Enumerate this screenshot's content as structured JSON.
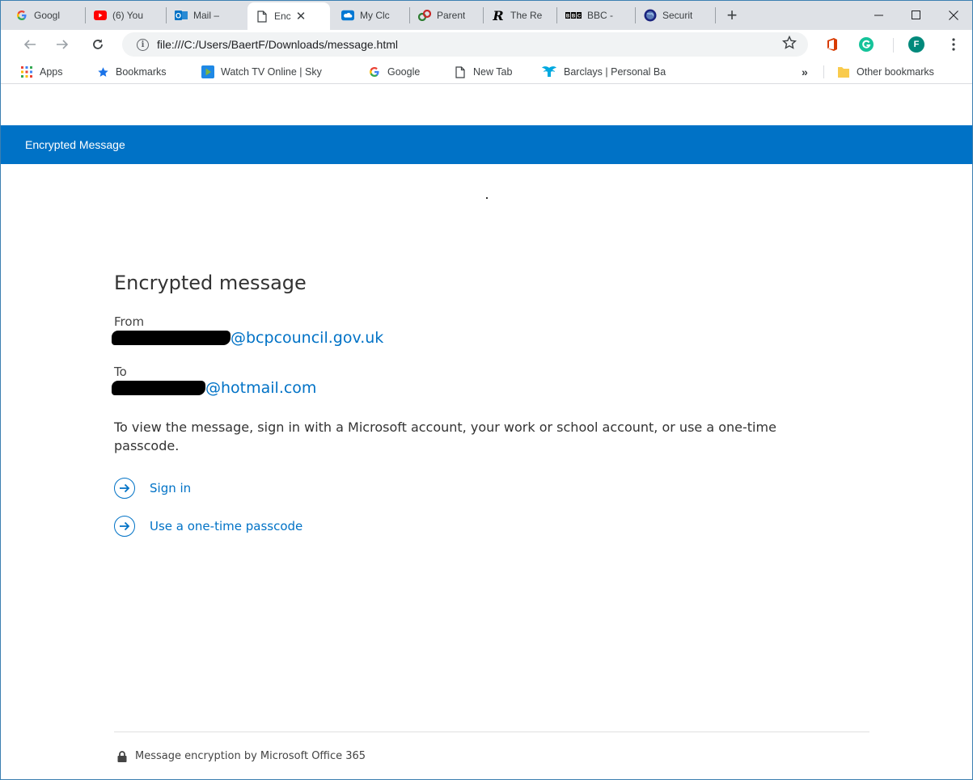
{
  "browser": {
    "tabs": [
      {
        "label": "Googl",
        "icon": "google-icon",
        "color": "#4285f4"
      },
      {
        "label": "(6) You",
        "icon": "youtube-icon",
        "color": "#ff0000"
      },
      {
        "label": "Mail –",
        "icon": "outlook-icon",
        "color": "#0072c6"
      },
      {
        "label": "Enc",
        "icon": "document-icon",
        "color": "#5f6368",
        "active": true
      },
      {
        "label": "My Clc",
        "icon": "cloud-icon",
        "color": "#0078d4"
      },
      {
        "label": "Parent",
        "icon": "parent-icon",
        "color": "#2e7d32"
      },
      {
        "label": "The Re",
        "icon": "the-r-icon",
        "color": "#000000"
      },
      {
        "label": "BBC - ",
        "icon": "bbc-icon",
        "color": "#000000"
      },
      {
        "label": "Securit",
        "icon": "globe-icon",
        "color": "#1a237e"
      }
    ],
    "tab_close_glyph": "✕",
    "new_tab_glyph": "+",
    "window_controls": {
      "minimize": "—",
      "maximize": "☐",
      "close": "✕"
    },
    "address_url": "file:///C:/Users/BaertF/Downloads/message.html",
    "profile_initial": "F",
    "bookmarks": [
      {
        "label": "Apps",
        "icon": "apps-grid-icon"
      },
      {
        "label": "Bookmarks",
        "icon": "star-icon"
      },
      {
        "label": "Watch TV Online | Sky",
        "icon": "play-icon"
      },
      {
        "label": "Google",
        "icon": "google-icon"
      },
      {
        "label": "New Tab",
        "icon": "document-icon"
      },
      {
        "label": "Barclays | Personal Ba",
        "icon": "eagle-icon"
      }
    ],
    "bookmarks_overflow": "»",
    "other_bookmarks": "Other bookmarks"
  },
  "page": {
    "appbar_title": "Encrypted Message",
    "heading": "Encrypted message",
    "from_label": "From",
    "from_domain": "@bcpcouncil.gov.uk",
    "to_label": "To",
    "to_domain": "@hotmail.com",
    "instructions": "To view the message, sign in with a Microsoft account, your work or school account, or use a one-time passcode.",
    "actions": [
      {
        "label": "Sign in"
      },
      {
        "label": "Use a one-time passcode"
      }
    ],
    "footer_text": "Message encryption by Microsoft Office 365"
  },
  "colors": {
    "accent": "#0072c6",
    "tabstrip": "#dee1e6"
  }
}
